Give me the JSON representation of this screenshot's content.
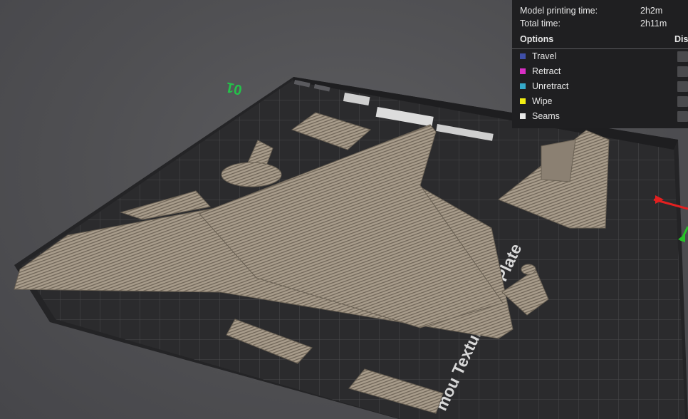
{
  "plate": {
    "number_label": "01",
    "brand_label": "mou Textured PEI Plate"
  },
  "stats": {
    "rows": [
      {
        "label": "Model printing time:",
        "value": "2h2m"
      },
      {
        "label": "Total time:",
        "value": "2h11m"
      }
    ]
  },
  "options": {
    "header": "Options",
    "display_header": "Dis",
    "items": [
      {
        "label": "Travel",
        "color": "#3f4fa8"
      },
      {
        "label": "Retract",
        "color": "#d82fc4"
      },
      {
        "label": "Unretract",
        "color": "#35a9c9"
      },
      {
        "label": "Wipe",
        "color": "#f2ee13"
      },
      {
        "label": "Seams",
        "color": "#e8e8e8"
      }
    ]
  },
  "colors": {
    "background": "#505053",
    "bed": "#2c2c2e",
    "model": "#9e9282",
    "panel": "#1f1f21",
    "axis_x": "#e32020",
    "axis_y": "#27c227"
  }
}
